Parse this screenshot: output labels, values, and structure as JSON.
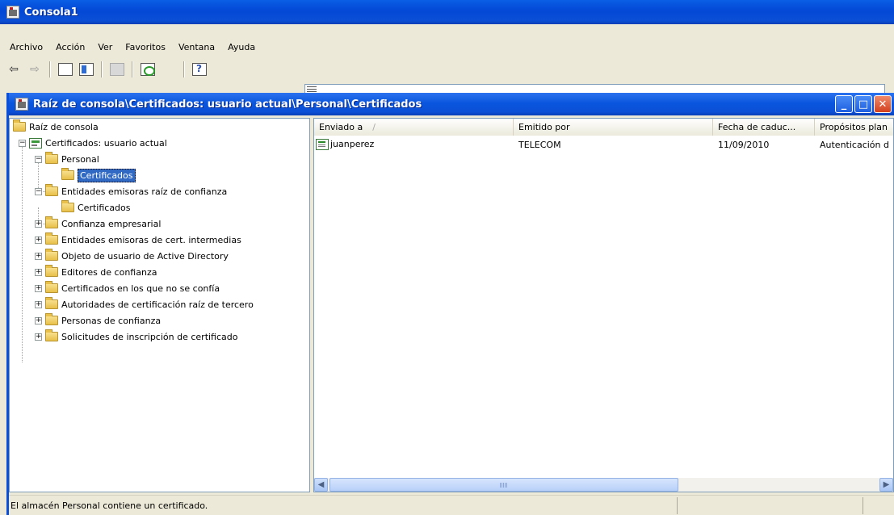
{
  "window": {
    "title": "Consola1"
  },
  "menu": [
    "Archivo",
    "Acción",
    "Ver",
    "Favoritos",
    "Ventana",
    "Ayuda"
  ],
  "toolbar": {
    "buttons": [
      {
        "name": "back-arrow-icon",
        "glyph": "⇦"
      },
      {
        "name": "forward-arrow-icon",
        "glyph": "⇨"
      }
    ]
  },
  "mdi": {
    "title": "Raíz de consola\\Certificados: usuario actual\\Personal\\Certificados"
  },
  "tree": {
    "root": "Raíz de consola",
    "store": "Certificados: usuario actual",
    "personal": "Personal",
    "personal_certs": "Certificados",
    "trusted_root": "Entidades emisoras raíz de confianza",
    "trusted_root_certs": "Certificados",
    "items": [
      "Confianza empresarial",
      "Entidades emisoras de cert. intermedias",
      "Objeto de usuario de Active Directory",
      "Editores de confianza",
      "Certificados en los que no se confía",
      "Autoridades de certificación raíz de tercero",
      "Personas de confianza",
      "Solicitudes de inscripción de certificado"
    ]
  },
  "list": {
    "columns": [
      "Enviado a",
      "Emitido por",
      "Fecha de caduc...",
      "Propósitos plan"
    ],
    "sort_indicator": "/",
    "rows": [
      {
        "issued_to": "juanperez",
        "issued_by": "TELECOM",
        "expiry": "11/09/2010",
        "purposes": "Autenticación d"
      }
    ]
  },
  "status": {
    "text": "El almacén Personal contiene un certificado."
  }
}
